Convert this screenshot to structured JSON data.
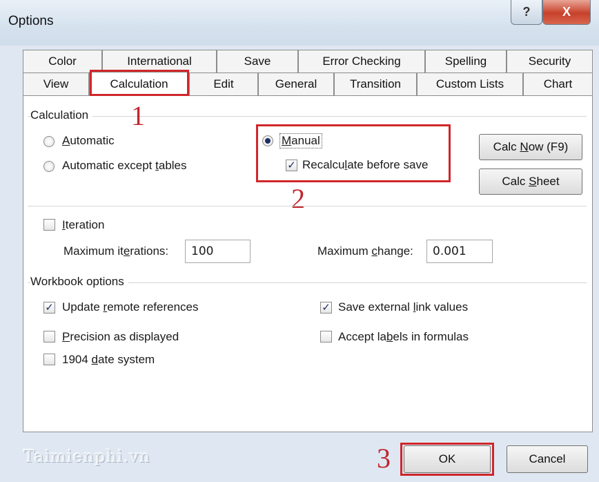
{
  "window": {
    "title": "Options",
    "help_glyph": "?",
    "close_glyph": "X"
  },
  "tabs": {
    "row1": [
      "Color",
      "International",
      "Save",
      "Error Checking",
      "Spelling",
      "Security"
    ],
    "row2": [
      "View",
      "Calculation",
      "Edit",
      "General",
      "Transition",
      "Custom Lists",
      "Chart"
    ],
    "active": "Calculation"
  },
  "calculation": {
    "group_label": "Calculation",
    "automatic": "Automatic",
    "automatic_except_tables": "Automatic except tables",
    "manual": "Manual",
    "recalculate": "Recalculate before save",
    "selected": "Manual",
    "recalculate_checked": true,
    "calc_now_button": "Calc Now (F9)",
    "calc_sheet_button": "Calc Sheet"
  },
  "iteration": {
    "label": "Iteration",
    "checked": false,
    "max_iterations_label": "Maximum iterations:",
    "max_iterations_value": "100",
    "max_change_label": "Maximum change:",
    "max_change_value": "0.001"
  },
  "workbook": {
    "group_label": "Workbook options",
    "update_remote": "Update remote references",
    "update_remote_checked": true,
    "precision": "Precision as displayed",
    "precision_checked": false,
    "date_1904": "1904 date system",
    "date_1904_checked": false,
    "save_external": "Save external link values",
    "save_external_checked": true,
    "accept_labels": "Accept labels in formulas",
    "accept_labels_checked": false
  },
  "footer": {
    "ok": "OK",
    "cancel": "Cancel",
    "watermark": "Taimienphi.vn"
  },
  "annotations": {
    "step1": "1",
    "step2": "2",
    "step3": "3",
    "color": "#d0262a"
  },
  "check_glyph": "✓"
}
